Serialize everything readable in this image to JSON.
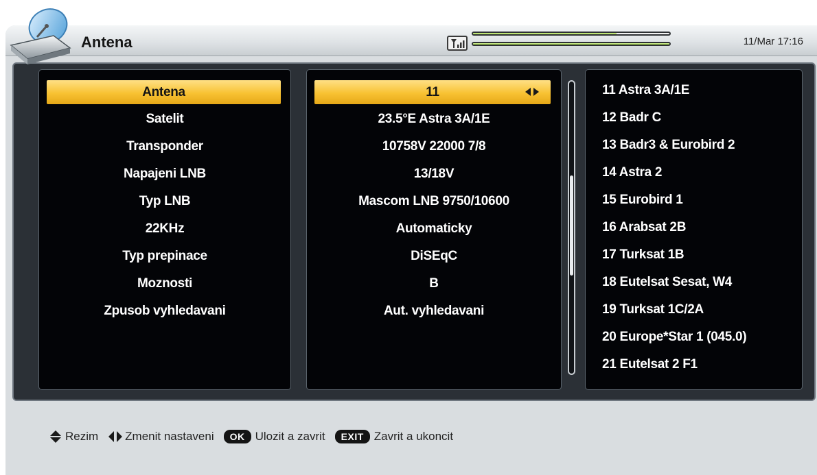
{
  "header": {
    "title": "Antena",
    "datetime": "11/Mar 17:16",
    "signal_strength": 0.73,
    "signal_quality": 1.0
  },
  "settings": [
    {
      "label": "Antena",
      "value": "11"
    },
    {
      "label": "Satelit",
      "value": "23.5°E Astra 3A/1E"
    },
    {
      "label": "Transponder",
      "value": "10758V 22000 7/8"
    },
    {
      "label": "Napajeni LNB",
      "value": "13/18V"
    },
    {
      "label": "Typ LNB",
      "value": "Mascom LNB 9750/10600"
    },
    {
      "label": "22KHz",
      "value": "Automaticky"
    },
    {
      "label": "Typ prepinace",
      "value": "DiSEqC"
    },
    {
      "label": "Moznosti",
      "value": "B"
    },
    {
      "label": "Zpusob vyhledavani",
      "value": "Aut. vyhledavani"
    }
  ],
  "satellite_list": [
    "11 Astra 3A/1E",
    "12 Badr C",
    "13 Badr3 & Eurobird 2",
    "14 Astra 2",
    "15 Eurobird 1",
    "16 Arabsat 2B",
    "17 Turksat 1B",
    "18 Eutelsat Sesat, W4",
    "19 Turksat 1C/2A",
    "20 Europe*Star 1 (045.0)",
    "21 Eutelsat 2 F1"
  ],
  "help": {
    "updown_text": "Rezim",
    "leftright_text": "Zmenit nastaveni",
    "ok_key": "OK",
    "ok_text": "Ulozit a zavrit",
    "exit_key": "EXIT",
    "exit_text": "Zavrit a ukoncit"
  },
  "colors": {
    "highlight": "#f8c233",
    "panel_bg": "#030407",
    "frame_bg": "#d9dde0"
  }
}
